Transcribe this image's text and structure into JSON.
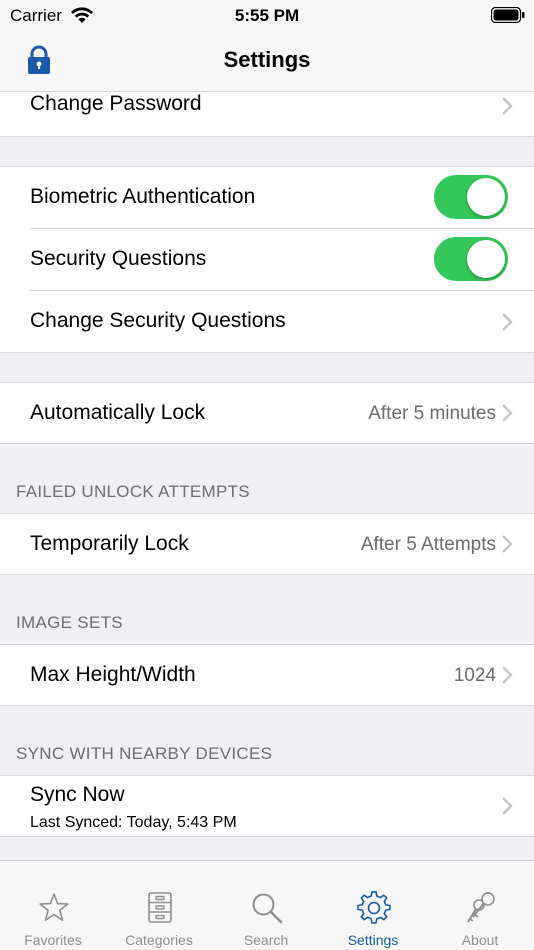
{
  "status_bar": {
    "carrier": "Carrier",
    "time": "5:55 PM"
  },
  "nav": {
    "title": "Settings"
  },
  "rows": {
    "change_password": {
      "label": "Change Password"
    },
    "biometric": {
      "label": "Biometric Authentication",
      "enabled": true
    },
    "security_questions": {
      "label": "Security Questions",
      "enabled": true
    },
    "change_security_questions": {
      "label": "Change Security Questions"
    },
    "auto_lock": {
      "label": "Automatically Lock",
      "value": "After 5 minutes"
    },
    "temp_lock": {
      "label": "Temporarily Lock",
      "value": "After 5 Attempts"
    },
    "max_size": {
      "label": "Max Height/Width",
      "value": "1024"
    },
    "sync_now": {
      "label": "Sync Now",
      "subtitle": "Last Synced: Today, 5:43 PM"
    }
  },
  "sections": {
    "failed_unlock": "FAILED UNLOCK ATTEMPTS",
    "image_sets": "IMAGE SETS",
    "sync": "SYNC WITH NEARBY DEVICES"
  },
  "tabs": [
    {
      "label": "Favorites",
      "icon": "star-icon",
      "active": false
    },
    {
      "label": "Categories",
      "icon": "cabinet-icon",
      "active": false
    },
    {
      "label": "Search",
      "icon": "magnifier-icon",
      "active": false
    },
    {
      "label": "Settings",
      "icon": "gear-icon",
      "active": true
    },
    {
      "label": "About",
      "icon": "keys-icon",
      "active": false
    }
  ],
  "colors": {
    "accent": "#1a5aa6",
    "toggle_on": "#34c759",
    "background": "#efeff4",
    "secondary_text": "#6d6d72"
  }
}
